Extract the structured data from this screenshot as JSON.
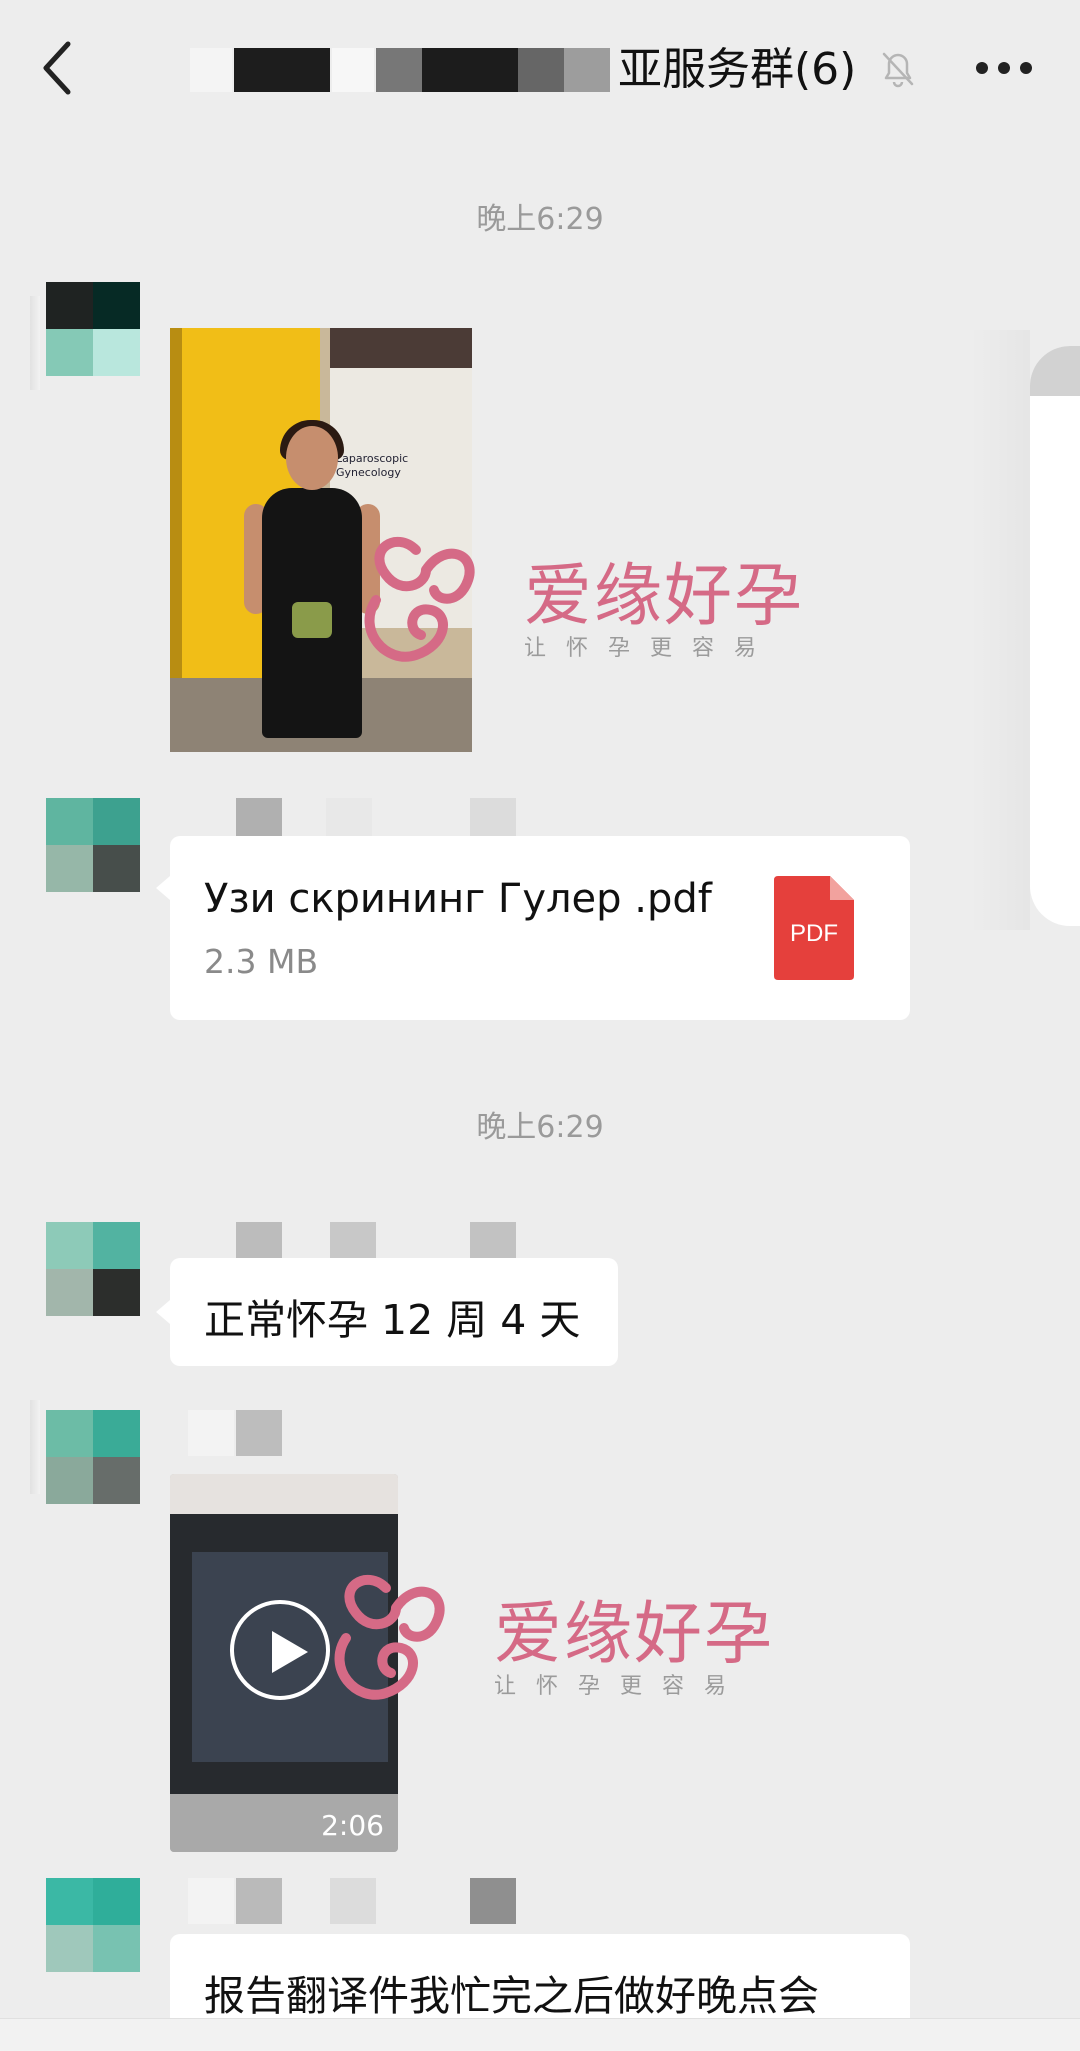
{
  "header": {
    "title": "亚服务群(6)",
    "back_icon": "chevron-left-icon",
    "mute_icon": "bell-off-icon",
    "more_icon": "ellipsis-icon"
  },
  "timestamps": [
    "晚上6:29",
    "晚上6:29"
  ],
  "photo_message": {
    "banner_text": "Laparoscopic Gynecology"
  },
  "watermark": {
    "text": "爱缘好孕",
    "subtitle": "让怀孕更容易"
  },
  "file_message": {
    "file_name": "Узи скрининг Гулер .pdf",
    "file_size": "2.3 MB",
    "file_type_label": "PDF",
    "file_icon": "pdf-file-icon",
    "icon_color": "#e5403c"
  },
  "text_messages": [
    "正常怀孕 12 周 4 天",
    "报告翻译件我忙完之后做好晚点会"
  ],
  "video_message": {
    "duration": "2:06",
    "play_icon": "play-icon"
  },
  "colors": {
    "background": "#ededed",
    "bubble": "#ffffff",
    "watermark": "#d56a86"
  }
}
